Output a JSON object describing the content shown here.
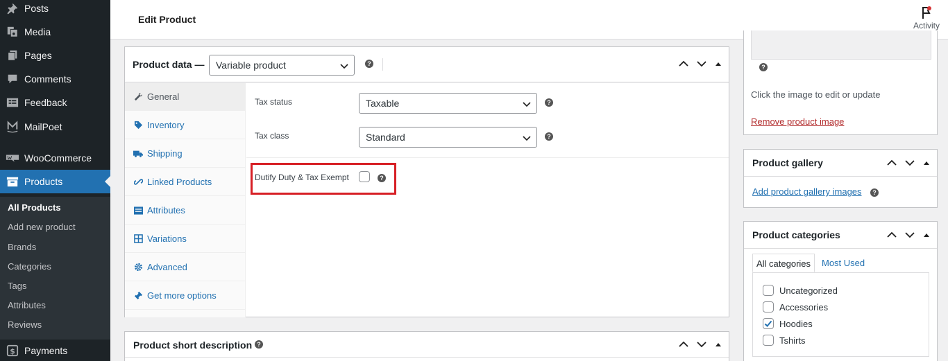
{
  "sidebar": {
    "items": [
      {
        "label": "Posts",
        "icon": "pushpin-icon"
      },
      {
        "label": "Media",
        "icon": "media-icon"
      },
      {
        "label": "Pages",
        "icon": "pages-icon"
      },
      {
        "label": "Comments",
        "icon": "comment-icon"
      },
      {
        "label": "Feedback",
        "icon": "feedback-icon"
      },
      {
        "label": "MailPoet",
        "icon": "mailpoet-icon"
      },
      {
        "label": "WooCommerce",
        "icon": "woo-icon"
      },
      {
        "label": "Products",
        "icon": "archive-icon"
      },
      {
        "label": "Payments",
        "icon": "dollar-icon"
      }
    ],
    "submenu": [
      "All Products",
      "Add new product",
      "Brands",
      "Categories",
      "Tags",
      "Attributes",
      "Reviews"
    ]
  },
  "header": {
    "title": "Edit Product",
    "activity_label": "Activity"
  },
  "product_data": {
    "title": "Product data —",
    "type_value": "Variable product",
    "tabs": [
      {
        "label": "General",
        "icon": "wrench-icon"
      },
      {
        "label": "Inventory",
        "icon": "tag-icon"
      },
      {
        "label": "Shipping",
        "icon": "truck-icon"
      },
      {
        "label": "Linked Products",
        "icon": "link-icon"
      },
      {
        "label": "Attributes",
        "icon": "list-icon"
      },
      {
        "label": "Variations",
        "icon": "grid-icon"
      },
      {
        "label": "Advanced",
        "icon": "gear-icon"
      },
      {
        "label": "Get more options",
        "icon": "plugin-icon"
      }
    ],
    "fields": {
      "tax_status_label": "Tax status",
      "tax_status_value": "Taxable",
      "tax_class_label": "Tax class",
      "tax_class_value": "Standard",
      "dutify_label": "Dutify Duty & Tax Exempt",
      "dutify_checked": false
    },
    "help_glyph": "?"
  },
  "short_description": {
    "title": "Product short description"
  },
  "product_image": {
    "hint": "Click the image to edit or update",
    "remove_link": "Remove product image"
  },
  "product_gallery": {
    "title": "Product gallery",
    "add_link": "Add product gallery images"
  },
  "product_categories": {
    "title": "Product categories",
    "tab_all": "All categories",
    "tab_most_used": "Most Used",
    "items": [
      {
        "label": "Uncategorized",
        "checked": false
      },
      {
        "label": "Accessories",
        "checked": false
      },
      {
        "label": "Hoodies",
        "checked": true
      },
      {
        "label": "Tshirts",
        "checked": false
      }
    ]
  },
  "colors": {
    "sidebar_bg": "#1d2327",
    "accent": "#2271b1",
    "highlight_box": "#d71f25"
  }
}
